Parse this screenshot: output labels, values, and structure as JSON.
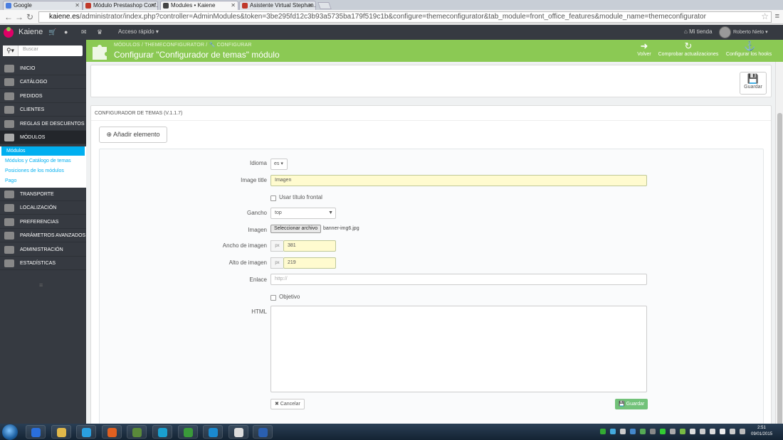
{
  "browser": {
    "tabs": [
      {
        "label": "Google",
        "color": "#4a7ee0"
      },
      {
        "label": "Módulo Prestashop Conf…",
        "color": "#c0392b"
      },
      {
        "label": "Modules • Kaiene",
        "color": "#444"
      },
      {
        "label": "Asistente Virtual Stephan…",
        "color": "#c0392b"
      }
    ],
    "url_domain": "kaiene.es",
    "url_path": "/administrator/index.php?controller=AdminModules&token=3be295fd12c3b93a5735ba179f519c1b&configure=themeconfigurator&tab_module=front_office_features&module_name=themeconfigurator"
  },
  "admin_bar": {
    "brand": "Kaiene",
    "quick_access": "Acceso rápido ▾",
    "my_shop": "Mi tienda",
    "user": "Roberto Nieto ▾"
  },
  "sidebar": {
    "search_placeholder": "Buscar",
    "items": [
      {
        "label": "Inicio"
      },
      {
        "label": "Catálogo"
      },
      {
        "label": "Pedidos"
      },
      {
        "label": "Clientes"
      },
      {
        "label": "Reglas de descuentos"
      },
      {
        "label": "Módulos"
      },
      {
        "label": "Transporte"
      },
      {
        "label": "Localización"
      },
      {
        "label": "Preferencias"
      },
      {
        "label": "Parámetros avanzados"
      },
      {
        "label": "Administración"
      },
      {
        "label": "Estadísticas"
      }
    ],
    "submenu": [
      {
        "label": "Módulos"
      },
      {
        "label": "Módulos y Catálogo de temas"
      },
      {
        "label": "Posiciones de los módulos"
      },
      {
        "label": "Pago"
      }
    ]
  },
  "header": {
    "breadcrumb": "MÓDULOS   /   THEMECONFIGURATOR   /   🔧 CONFIGURAR",
    "title": "Configurar \"Configurador de temas\" módulo",
    "actions": {
      "back": "Volver",
      "updates": "Comprobar actualizaciones",
      "hooks": "Configurar los hooks"
    }
  },
  "toolbar": {
    "save": "Guardar"
  },
  "panel": {
    "heading": "Configurador de temas (v.1.1.7)",
    "add_element": "Añadir elemento"
  },
  "form": {
    "language_label": "Idioma",
    "language_value": "es ▾",
    "image_title_label": "Image title",
    "image_title_value": "Imagen",
    "use_front_title": "Usar título frontal",
    "hook_label": "Gancho",
    "hook_value": "top",
    "image_label": "Imagen",
    "file_button": "Seleccionar archivo",
    "file_name": "banner-img6.jpg",
    "width_label": "Ancho de imagen",
    "width_unit": "px",
    "width_value": "381",
    "height_label": "Alto de imagen",
    "height_unit": "px",
    "height_value": "219",
    "link_label": "Enlace",
    "link_placeholder": "http://",
    "target_label": "Objetivo",
    "html_label": "HTML",
    "cancel": "✖ Cancelar",
    "save": "💾 Guardar"
  },
  "taskbar": {
    "time": "2:51",
    "date": "09/01/2015",
    "apps": [
      "#2a6fdc",
      "#e0b84a",
      "#2aa0e0",
      "#e06020",
      "#5a8a3a",
      "#1aa0d0",
      "#3a9a3a",
      "#1a8ad0",
      "#ddd",
      "#2a5fb0"
    ]
  }
}
